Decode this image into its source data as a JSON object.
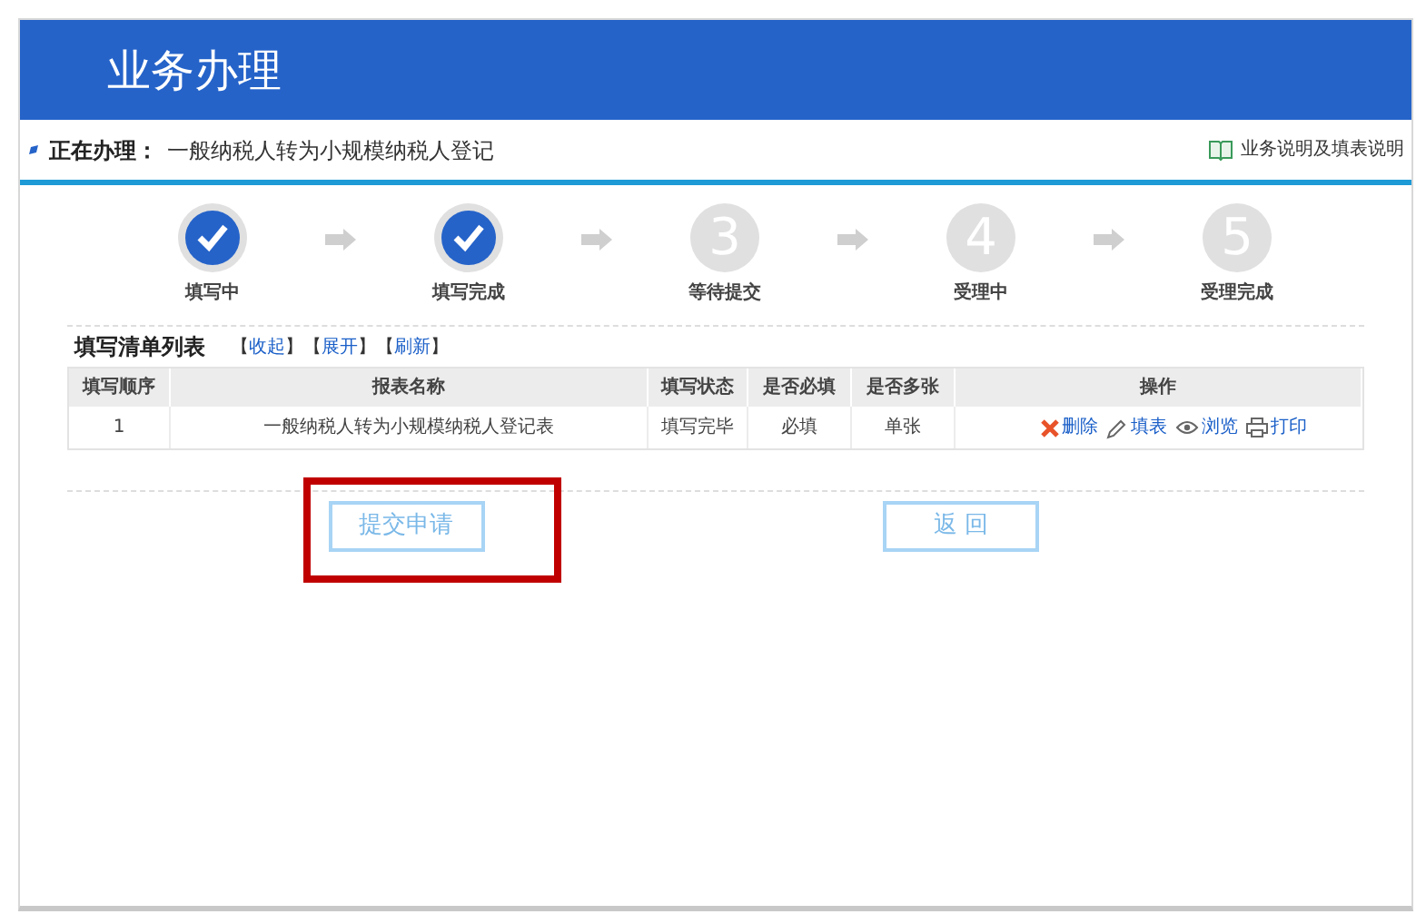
{
  "header": {
    "title": "业务办理"
  },
  "current": {
    "label": "正在办理：",
    "value": "一般纳税人转为小规模纳税人登记"
  },
  "help_link": "业务说明及填表说明",
  "steps": [
    {
      "label": "填写中",
      "done": true
    },
    {
      "label": "填写完成",
      "done": true
    },
    {
      "label": "等待提交",
      "done": false,
      "number": "3"
    },
    {
      "label": "受理中",
      "done": false,
      "number": "4"
    },
    {
      "label": "受理完成",
      "done": false,
      "number": "5"
    }
  ],
  "list": {
    "title": "填写清单列表",
    "links": [
      {
        "open": "【",
        "text": "收起",
        "close": "】"
      },
      {
        "open": "【",
        "text": "展开",
        "close": "】"
      },
      {
        "open": "【",
        "text": "刷新",
        "close": "】"
      }
    ],
    "columns": [
      "填写顺序",
      "报表名称",
      "填写状态",
      "是否必填",
      "是否多张",
      "操作"
    ],
    "rows": [
      {
        "cells": [
          "1",
          "一般纳税人转为小规模纳税人登记表",
          "填写完毕",
          "必填",
          "单张"
        ],
        "actions": [
          {
            "kind": "delete",
            "text": "删除"
          },
          {
            "kind": "edit",
            "text": "填表"
          },
          {
            "kind": "view",
            "text": "浏览"
          },
          {
            "kind": "print",
            "text": "打印"
          }
        ]
      }
    ]
  },
  "buttons": [
    {
      "text": "提交申请",
      "highlighted": true
    },
    {
      "text": "返 回",
      "highlighted": false
    }
  ]
}
